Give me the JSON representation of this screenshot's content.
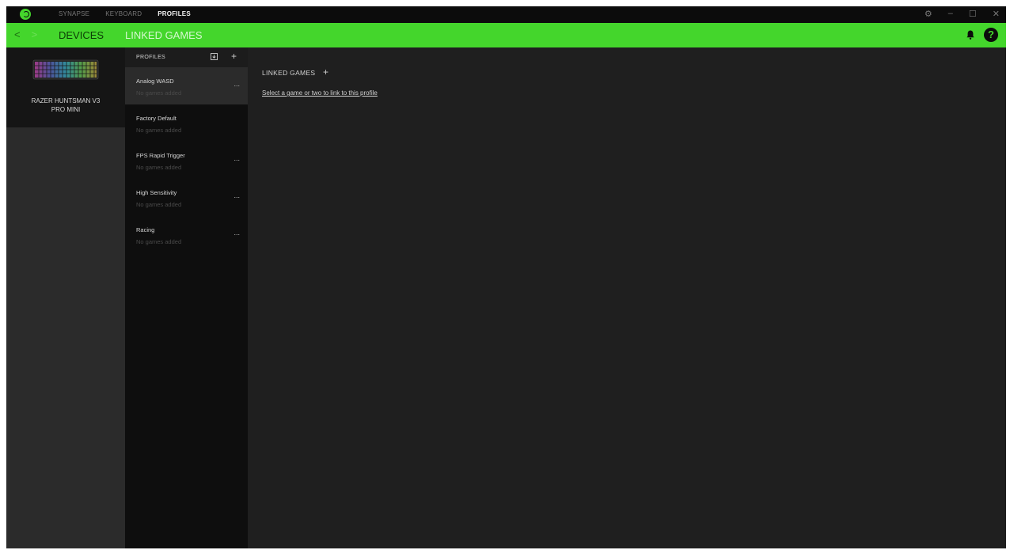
{
  "titlebar": {
    "nav": [
      "SYNAPSE",
      "KEYBOARD",
      "PROFILES"
    ],
    "active_nav": "PROFILES",
    "window_controls": {
      "settings": "⚙",
      "minimize": "–",
      "maximize": "☐",
      "close": "✕"
    }
  },
  "subnav": {
    "back": "<",
    "forward": ">",
    "tabs": [
      "DEVICES",
      "LINKED GAMES"
    ],
    "help": "?"
  },
  "device": {
    "name_line1": "RAZER HUNTSMAN V3",
    "name_line2": "PRO MINI"
  },
  "profiles": {
    "header": "PROFILES",
    "add": "+",
    "items": [
      {
        "name": "Analog WASD",
        "sub": "No games added",
        "more": "...",
        "selected": true
      },
      {
        "name": "Factory Default",
        "sub": "No games added",
        "more": "",
        "selected": false
      },
      {
        "name": "FPS Rapid Trigger",
        "sub": "No games added",
        "more": "...",
        "selected": false
      },
      {
        "name": "High Sensitivity",
        "sub": "No games added",
        "more": "...",
        "selected": false
      },
      {
        "name": "Racing",
        "sub": "No games added",
        "more": "...",
        "selected": false
      }
    ]
  },
  "main": {
    "title": "LINKED GAMES",
    "add": "+",
    "link_text": "Select a game or two to link to this profile"
  },
  "colors": {
    "accent": "#44d62c",
    "titlebar": "#0c0c0c",
    "panel": "#1f1f1f"
  }
}
